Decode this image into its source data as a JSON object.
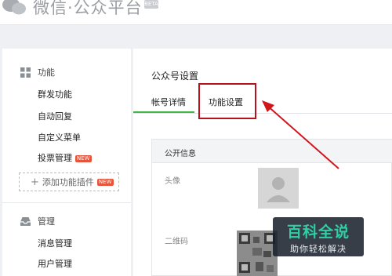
{
  "header": {
    "logo_text": "微信·公众平台",
    "logo_badge": "BETA"
  },
  "sidebar": {
    "sections": [
      {
        "title": "功能",
        "icon": "grid-icon",
        "items": [
          {
            "label": "群发功能"
          },
          {
            "label": "自动回复"
          },
          {
            "label": "自定义菜单"
          },
          {
            "label": "投票管理",
            "badge": "NEW"
          }
        ],
        "add_plugin_label": "添加功能插件",
        "add_plugin_badge": "NEW"
      },
      {
        "title": "管理",
        "icon": "inbox-icon",
        "items": [
          {
            "label": "消息管理"
          },
          {
            "label": "用户管理"
          }
        ]
      }
    ]
  },
  "main": {
    "page_title": "公众号设置",
    "tabs": [
      {
        "label": "帐号详情",
        "active": true
      },
      {
        "label": "功能设置",
        "active": false
      }
    ],
    "panel": {
      "header": "公开信息",
      "rows": [
        {
          "label": "头像",
          "value_icon": "avatar-placeholder-icon"
        },
        {
          "label": "二维码",
          "value_icon": "qrcode-icon"
        }
      ]
    }
  },
  "watermark": {
    "title": "百科全说",
    "subtitle": "助你轻松解决"
  },
  "colors": {
    "accent_green": "#44b549",
    "highlight_red": "#b5121b",
    "badge_red": "#e8543a",
    "watermark_teal": "#2fcfa6"
  }
}
